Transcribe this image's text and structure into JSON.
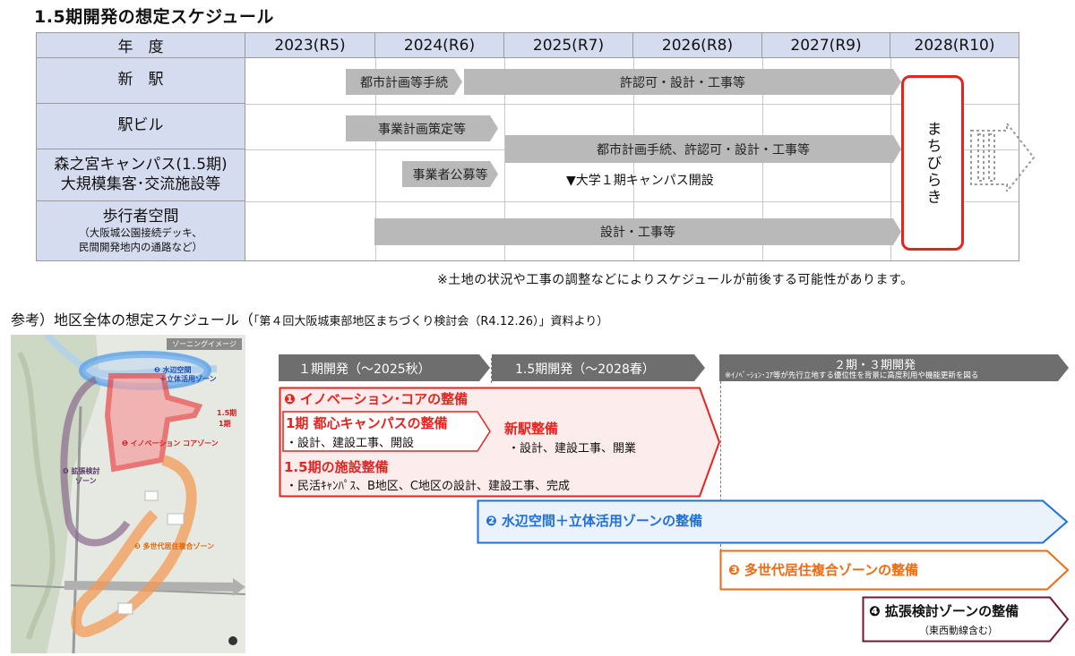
{
  "main_title": "1.5期開発の想定スケジュール",
  "table": {
    "header_label": "年　度",
    "years": [
      "2023(R5)",
      "2024(R6)",
      "2025(R7)",
      "2026(R8)",
      "2027(R9)",
      "2028(R10)"
    ],
    "rows": {
      "shin_eki": "新　駅",
      "eki_biru": "駅ビル",
      "campus_line1": "森之宮キャンパス(1.5期)",
      "campus_line2": "大規模集客･交流施設等",
      "pedestrian_main": "歩行者空間",
      "pedestrian_sub1": "（大阪城公園接続デッキ、",
      "pedestrian_sub2": "民間開発地内の通路など）"
    },
    "bars": {
      "toshi_keikaku": "都市計画等手続",
      "kyoninka_1": "許認可・設計・工事等",
      "jigyo_keikaku": "事業計画策定等",
      "toshi_kyoninka": "都市計画手続、許認可・設計・工事等",
      "jigyosha_boshu": "事業者公募等",
      "sekkei_koji": "設計・工事等"
    },
    "milestone": "▼大学１期キャンパス開設",
    "machibiraki": "まちびらき"
  },
  "note": "※土地の状況や工事の調整などによりスケジュールが前後する可能性があります。",
  "reference": {
    "title": "参考）地区全体の想定スケジュール（",
    "subtitle": "「第４回大阪城東部地区まちづくり検討会（R4.12.26）」資料より）"
  },
  "map": {
    "title": "ゾーニングイメージ",
    "zone1": "❶ イノベーション コアゾーン",
    "zone2_line1": "❷ 水辺空間",
    "zone2_line2": "＋立体活用ゾーン",
    "zone3": "❸ 多世代居住複合ゾーン",
    "zone4_line1": "❹ 拡張検討",
    "zone4_line2": "ゾーン",
    "phase_label_a": "1.5期",
    "phase_label_b": "1期"
  },
  "phases": {
    "p1": "１期開発（～2025秋）",
    "p15": "1.5期開発（～2028春）",
    "p23": "２期・３期開発",
    "p23_note": "※ｲﾉﾍﾞｰｼｮﾝ･ｺｱ等が先行立地する優位性を背景に高度利用や機能更新を図る"
  },
  "zones": {
    "z1_title": "❶ イノベーション･コアの整備",
    "z1_p1_title": "1期 都心キャンパスの整備",
    "z1_p1_detail": "・設計、建設工事、開設",
    "z1_station_title": "新駅整備",
    "z1_station_detail": "・設計、建設工事、開業",
    "z1_p15_title": "1.5期の施設整備",
    "z1_p15_detail": "・民活ｷｬﾝﾊﾟｽ、B地区、C地区の設計、建設工事、完成",
    "z2": "❷ 水辺空間＋立体活用ゾーンの整備",
    "z3": "❸ 多世代居住複合ゾーンの整備",
    "z4": "❹ 拡張検討ゾーンの整備",
    "z4_sub": "（東西動線含む）"
  },
  "colors": {
    "header_bg": "#d6dcef",
    "bar_gray": "#b9b9b9",
    "phase_gray": "#6e6e6e",
    "red": "#e8231e",
    "blue": "#1f6fe0",
    "orange": "#f06a10",
    "maroon": "#6b1a3a"
  }
}
